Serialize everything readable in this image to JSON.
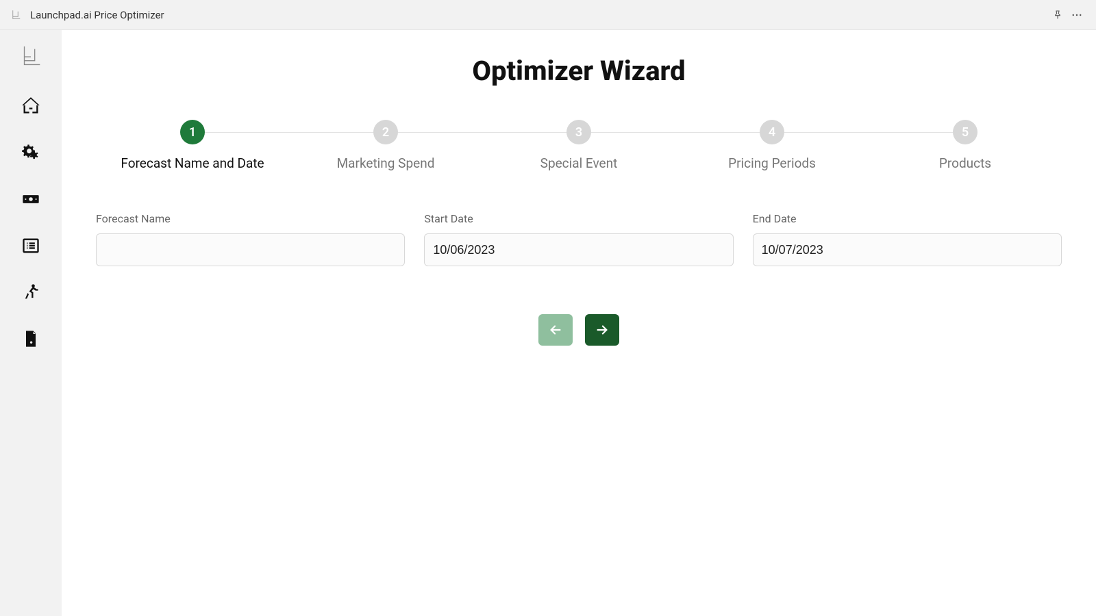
{
  "titlebar": {
    "title": "Launchpad.ai Price Optimizer"
  },
  "page": {
    "title": "Optimizer Wizard"
  },
  "steps": [
    {
      "num": "1",
      "label": "Forecast Name and Date",
      "active": true
    },
    {
      "num": "2",
      "label": "Marketing Spend",
      "active": false
    },
    {
      "num": "3",
      "label": "Special Event",
      "active": false
    },
    {
      "num": "4",
      "label": "Pricing Periods",
      "active": false
    },
    {
      "num": "5",
      "label": "Products",
      "active": false
    }
  ],
  "form": {
    "forecast_name": {
      "label": "Forecast Name",
      "value": ""
    },
    "start_date": {
      "label": "Start Date",
      "value": "10/06/2023"
    },
    "end_date": {
      "label": "End Date",
      "value": "10/07/2023"
    }
  },
  "colors": {
    "accent": "#1f7a3a",
    "accent_dark": "#1a5a2a",
    "inactive": "#d7d7d7"
  }
}
